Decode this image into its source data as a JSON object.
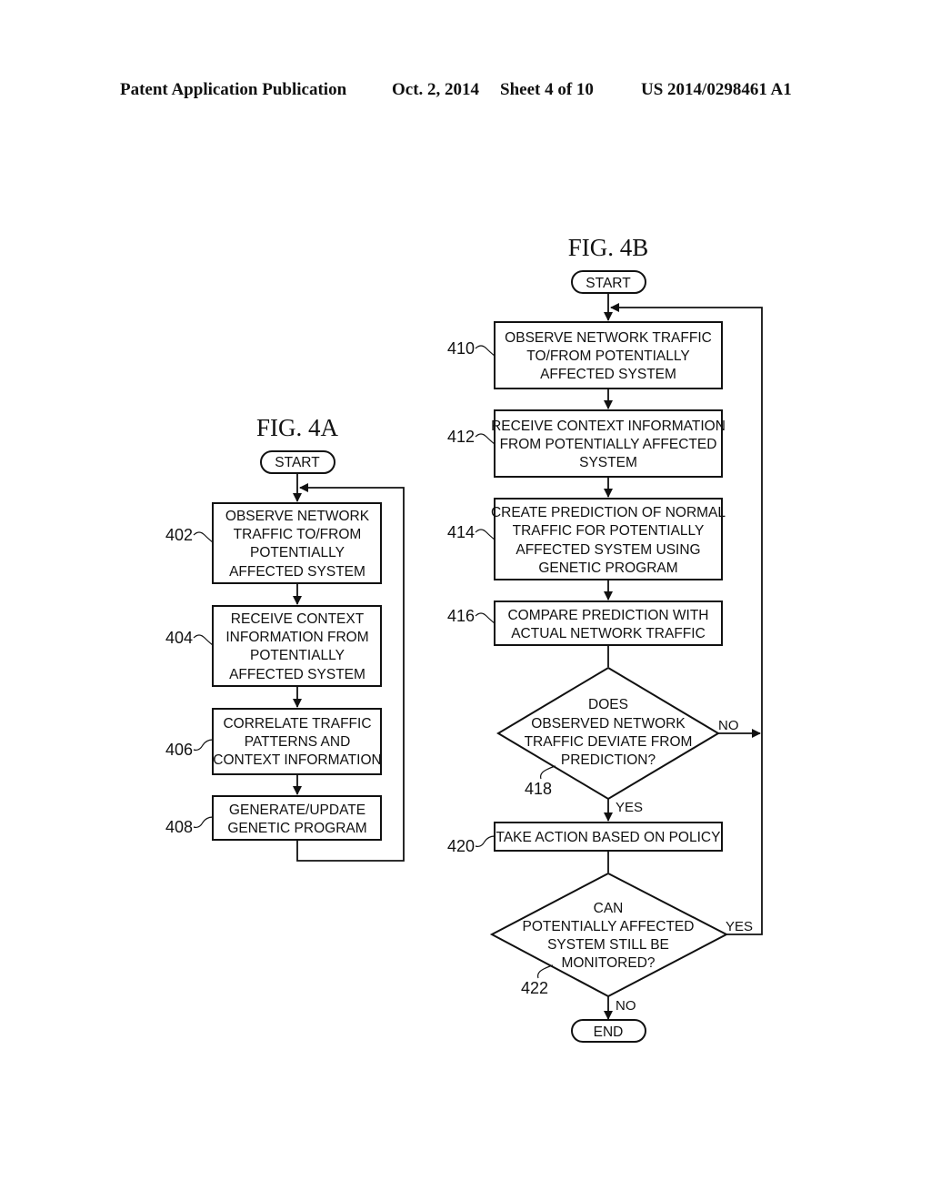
{
  "header": {
    "publication": "Patent Application Publication",
    "date": "Oct. 2, 2014",
    "sheet": "Sheet 4 of 10",
    "number": "US 2014/0298461 A1"
  },
  "fig4a": {
    "title": "FIG. 4A",
    "start": "START",
    "steps": [
      {
        "ref": "402",
        "lines": [
          "OBSERVE NETWORK",
          "TRAFFIC TO/FROM",
          "POTENTIALLY",
          "AFFECTED SYSTEM"
        ]
      },
      {
        "ref": "404",
        "lines": [
          "RECEIVE CONTEXT",
          "INFORMATION FROM",
          "POTENTIALLY",
          "AFFECTED SYSTEM"
        ]
      },
      {
        "ref": "406",
        "lines": [
          "CORRELATE TRAFFIC",
          "PATTERNS AND",
          "CONTEXT INFORMATION"
        ]
      },
      {
        "ref": "408",
        "lines": [
          "GENERATE/UPDATE",
          "GENETIC PROGRAM"
        ]
      }
    ]
  },
  "fig4b": {
    "title": "FIG. 4B",
    "start": "START",
    "end": "END",
    "steps": [
      {
        "ref": "410",
        "lines": [
          "OBSERVE NETWORK TRAFFIC",
          "TO/FROM POTENTIALLY",
          "AFFECTED SYSTEM"
        ]
      },
      {
        "ref": "412",
        "lines": [
          "RECEIVE CONTEXT INFORMATION",
          "FROM POTENTIALLY AFFECTED",
          "SYSTEM"
        ]
      },
      {
        "ref": "414",
        "lines": [
          "CREATE PREDICTION OF NORMAL",
          "TRAFFIC FOR POTENTIALLY",
          "AFFECTED SYSTEM USING",
          "GENETIC PROGRAM"
        ]
      },
      {
        "ref": "416",
        "lines": [
          "COMPARE PREDICTION WITH",
          "ACTUAL NETWORK TRAFFIC"
        ]
      },
      {
        "ref": "420",
        "lines": [
          "TAKE ACTION BASED ON POLICY"
        ]
      }
    ],
    "decisions": [
      {
        "ref": "418",
        "lines": [
          "DOES",
          "OBSERVED NETWORK",
          "TRAFFIC DEVIATE FROM",
          "PREDICTION?"
        ],
        "no_label": "NO",
        "yes_label": "YES"
      },
      {
        "ref": "422",
        "lines": [
          "CAN",
          "POTENTIALLY AFFECTED",
          "SYSTEM STILL BE",
          "MONITORED?"
        ],
        "yes_label": "YES",
        "no_label": "NO"
      }
    ]
  }
}
